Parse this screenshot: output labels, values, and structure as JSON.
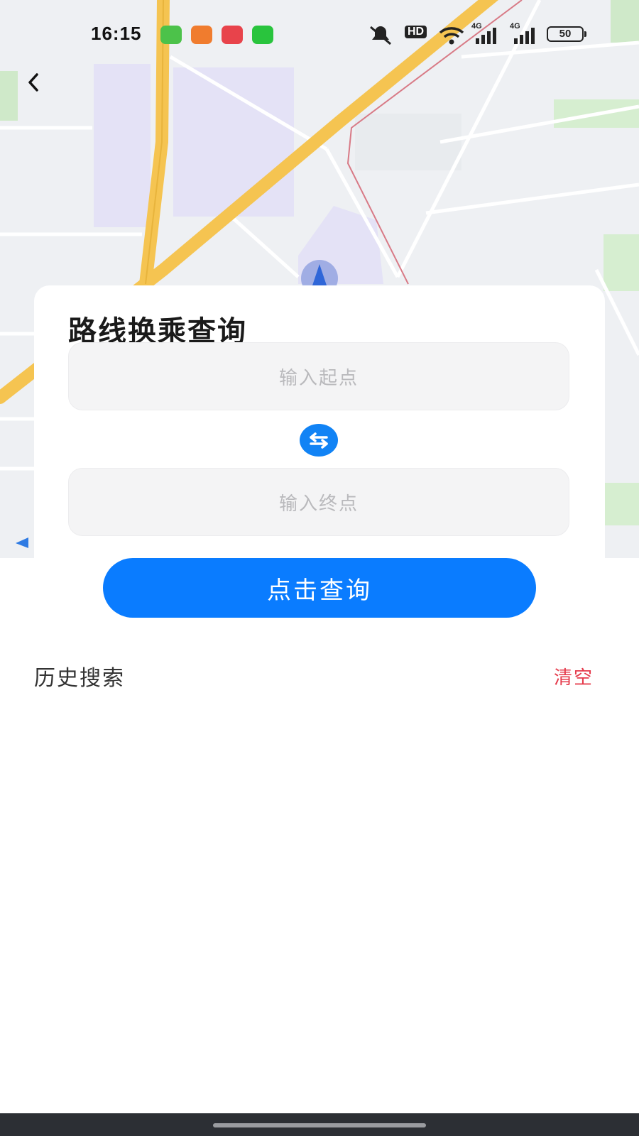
{
  "status_bar": {
    "time": "16:15",
    "app_icons": [
      "message-app-icon",
      "photos-app-icon",
      "video-app-icon",
      "store-app-icon"
    ],
    "network_labels": [
      "HD",
      "4G",
      "4G"
    ],
    "battery_level": "50"
  },
  "nav": {
    "back_icon": "chevron-left-icon"
  },
  "card": {
    "title": "路线换乘查询",
    "start_placeholder": "输入起点",
    "end_placeholder": "输入终点",
    "swap_icon": "swap-arrows-icon"
  },
  "query_button_label": "点击查询",
  "history": {
    "title": "历史搜索",
    "clear_label": "清空"
  },
  "colors": {
    "accent": "#0a7cff",
    "clear_red": "#e5394a",
    "map_road_major": "#f5c451",
    "map_block_purple": "#e6e4f7"
  }
}
